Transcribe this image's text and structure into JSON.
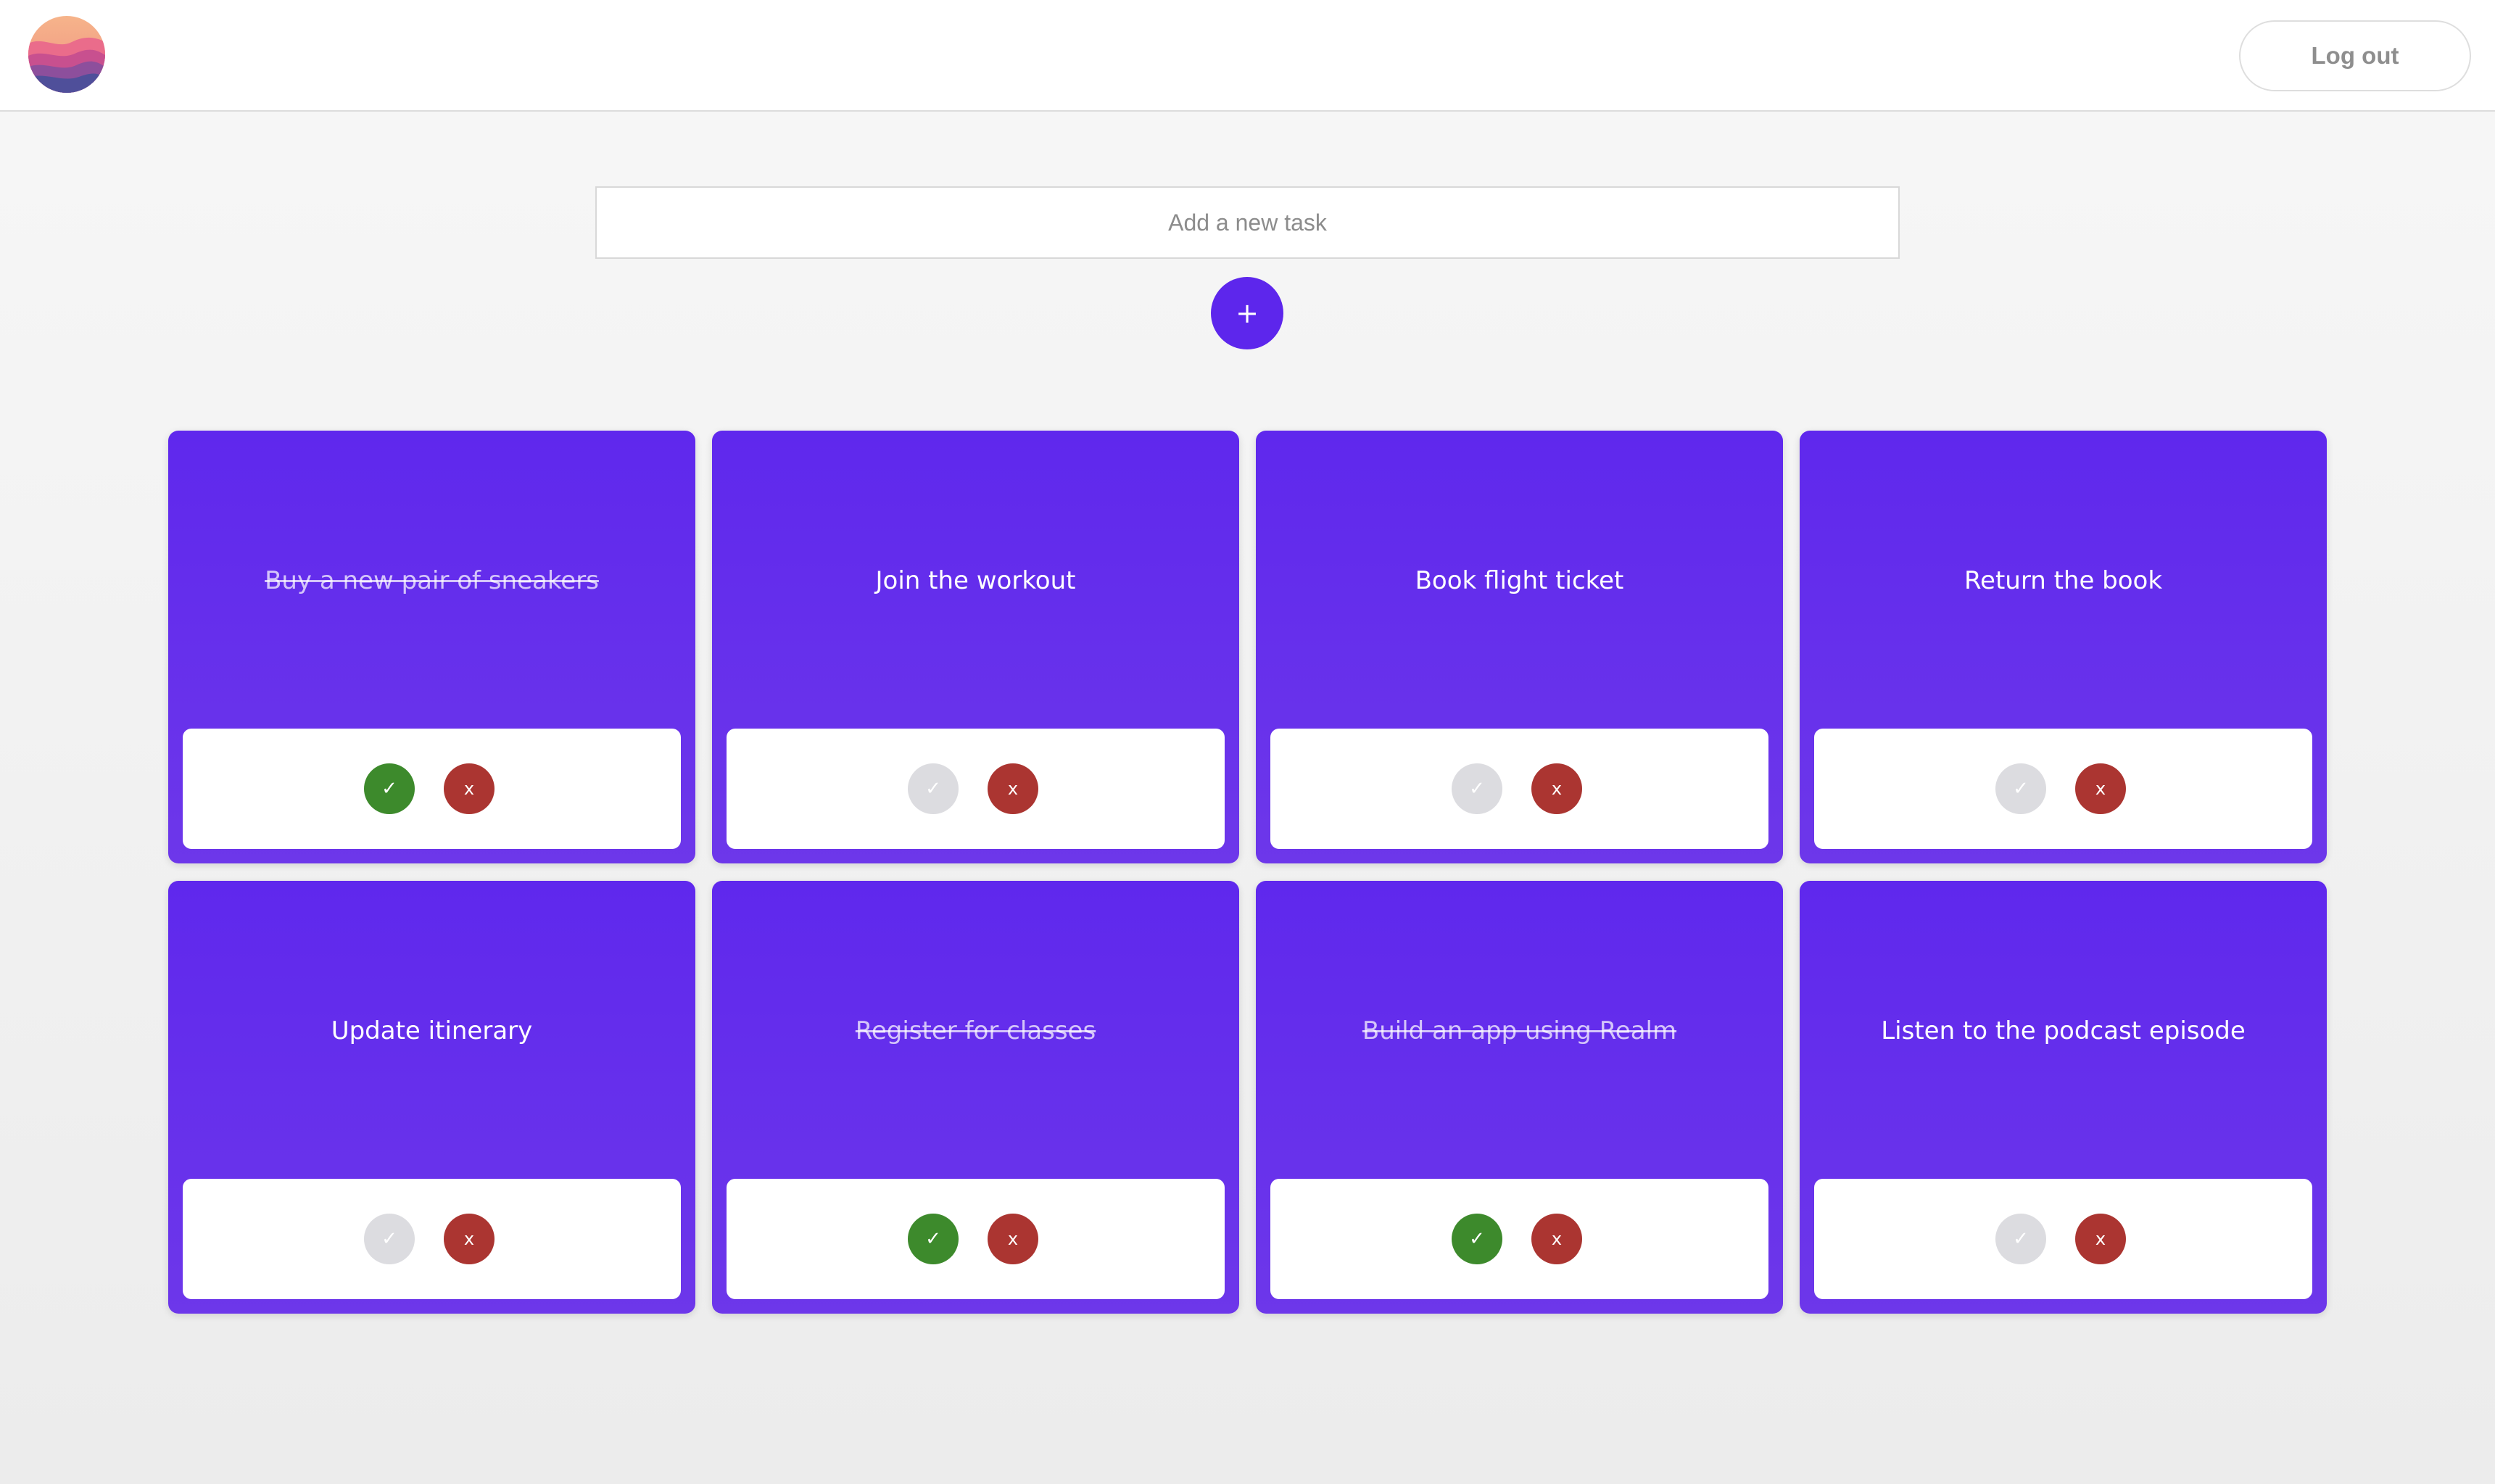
{
  "header": {
    "logout_label": "Log out"
  },
  "new_task": {
    "placeholder": "Add a new task",
    "add_label": "+"
  },
  "tasks": [
    {
      "title": "Buy a new pair of sneakers",
      "done": true
    },
    {
      "title": "Join the workout",
      "done": false
    },
    {
      "title": "Book flight ticket",
      "done": false
    },
    {
      "title": "Return the book",
      "done": false
    },
    {
      "title": "Update itinerary",
      "done": false
    },
    {
      "title": "Register for classes",
      "done": true
    },
    {
      "title": "Build an app using Realm",
      "done": true
    },
    {
      "title": "Listen to the podcast episode",
      "done": false
    }
  ],
  "controls": {
    "check_glyph": "✓",
    "delete_glyph": "x"
  },
  "colors": {
    "accent": "#5d26ec",
    "card_top": "#5f28ed",
    "card_bottom": "#6d37ea",
    "done": "#3d8a2c",
    "not_done": "#dcdce0",
    "delete": "#ab3531"
  },
  "icons": {
    "logo": "realm-logo-icon",
    "check": "check-icon",
    "delete": "delete-icon",
    "add": "plus-icon"
  }
}
